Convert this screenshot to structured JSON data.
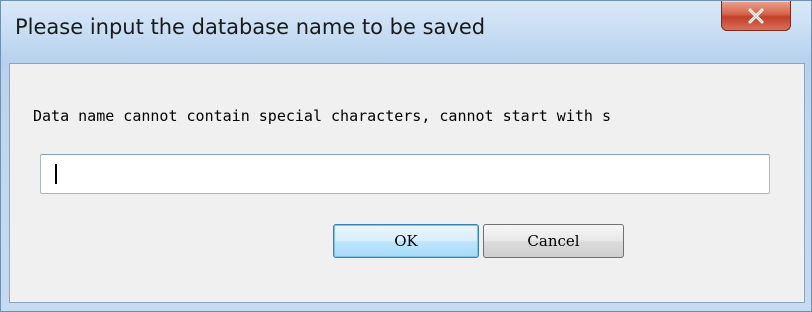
{
  "window": {
    "title": "Please input the database name to be saved",
    "close_glyph": "X"
  },
  "dialog": {
    "message": "Data name cannot contain special characters, cannot start with s",
    "input_value": "",
    "ok_label": "OK",
    "cancel_label": "Cancel"
  },
  "icons": {
    "close": "close-icon"
  },
  "colors": {
    "close_button": "#d6644b",
    "dialog_background": "#f0f0f0",
    "frame": "#c4dcf5",
    "default_button_border": "#3c7fb1"
  }
}
